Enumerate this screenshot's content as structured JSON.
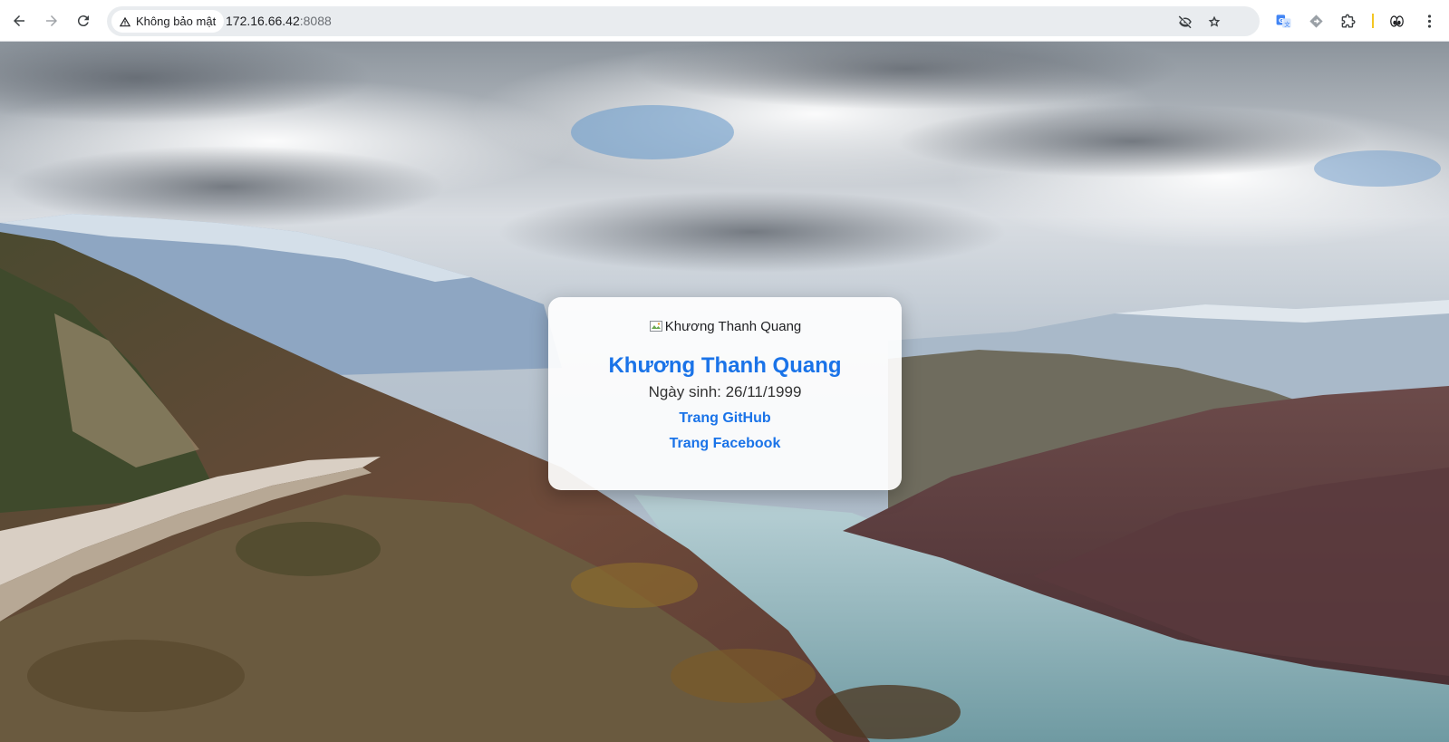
{
  "browser": {
    "security_label": "Không bảo mật",
    "url_host": "172.16.66.42",
    "url_port": ":8088",
    "icons": [
      "back-icon",
      "forward-icon",
      "reload-icon",
      "warning-icon",
      "eye-off-icon",
      "star-icon",
      "translate-icon",
      "extension-arrow-icon",
      "puzzle-icon",
      "eyes-icon",
      "more-vert-icon"
    ],
    "accent_color": "#f3c623"
  },
  "profile": {
    "avatar_alt": "Khương Thanh Quang",
    "name": "Khương Thanh Quang",
    "dob": "Ngày sinh: 26/11/1999",
    "github_label": "Trang GitHub",
    "facebook_label": "Trang Facebook",
    "link_color": "#1a73e8"
  }
}
